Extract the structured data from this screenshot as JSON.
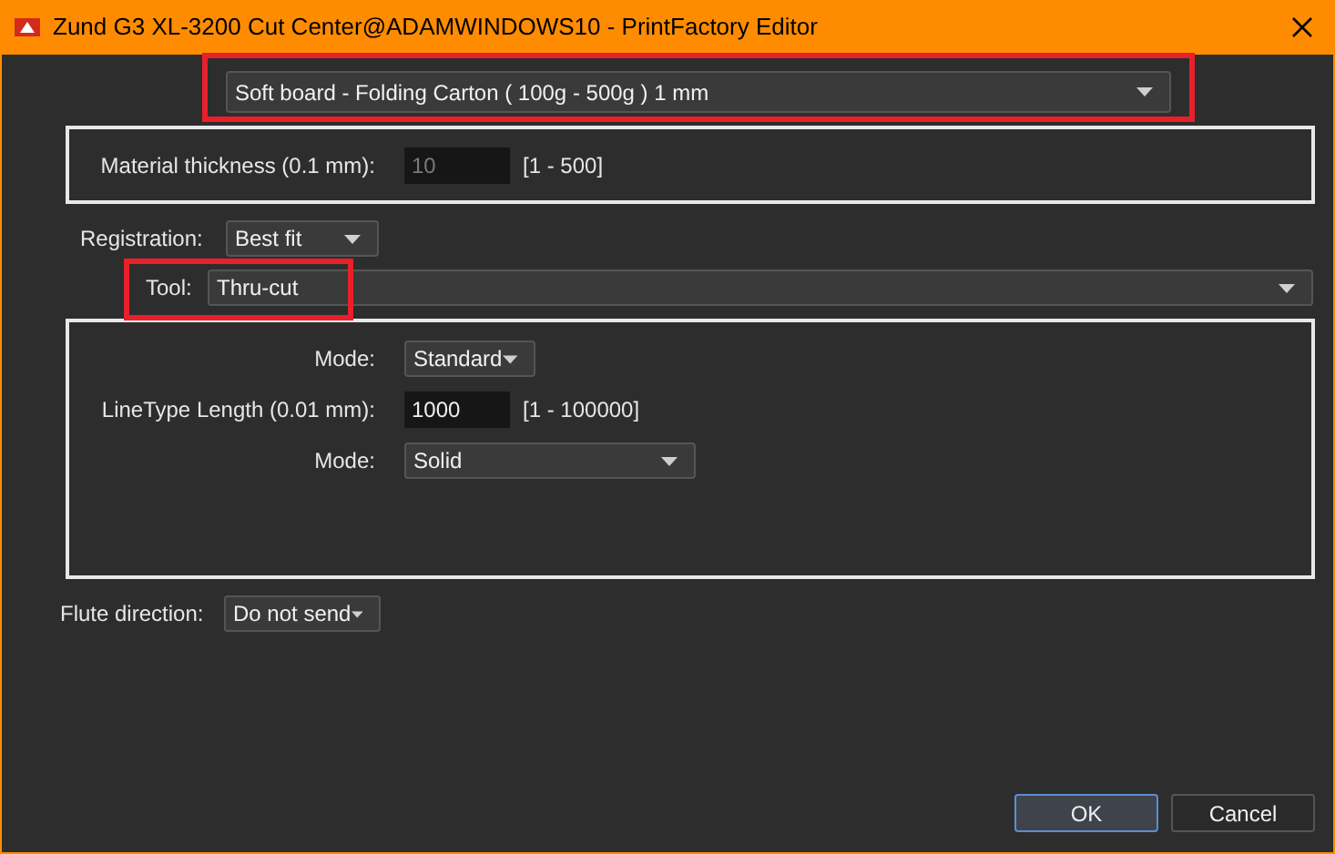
{
  "window": {
    "title": "Zund G3 XL-3200 Cut Center@ADAMWINDOWS10 - PrintFactory Editor"
  },
  "material": {
    "value": "Soft board - Folding Carton ( 100g - 500g ) 1 mm"
  },
  "material_settings": [
    {
      "kind": "number",
      "label": "Material thickness (0.1 mm):",
      "value": "10",
      "disabled": true,
      "range": "[1 - 500]"
    }
  ],
  "registration": {
    "label": "Registration:",
    "value": "Best fit"
  },
  "tool": {
    "label": "Tool:",
    "value": "Thru-cut"
  },
  "tool_settings": [
    {
      "kind": "dropdown",
      "label": "Mode:",
      "value": "Standard"
    },
    {
      "kind": "number",
      "label": "LineType Length (0.01 mm):",
      "value": "1000",
      "disabled": false,
      "range": "[1 - 100000]"
    },
    {
      "kind": "dropdown",
      "label": "Mode:",
      "value": "Solid"
    }
  ],
  "flute_direction": {
    "label": "Flute direction:",
    "value": "Do not send"
  },
  "buttons": [
    {
      "label": "OK",
      "selected": true
    },
    {
      "label": "Cancel",
      "selected": false
    }
  ]
}
